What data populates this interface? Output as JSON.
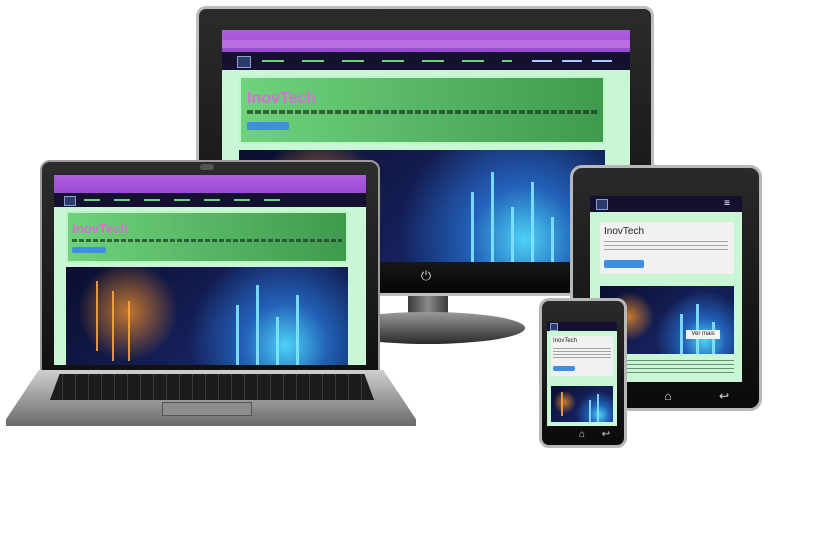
{
  "brand": {
    "name": "InovTech"
  },
  "tablet": {
    "button_label": "Ver mais"
  },
  "icons": {
    "power": "power-icon",
    "home": "home-icon",
    "back": "back-icon",
    "menu": "hamburger-menu-icon",
    "logo": "site-logo-icon"
  },
  "colors": {
    "brand_pink": "#d96fd6",
    "hero_green": "#52b862",
    "navbar": "#141030",
    "browser_tab": "#a355dc",
    "button_blue": "#3e8ee6"
  }
}
